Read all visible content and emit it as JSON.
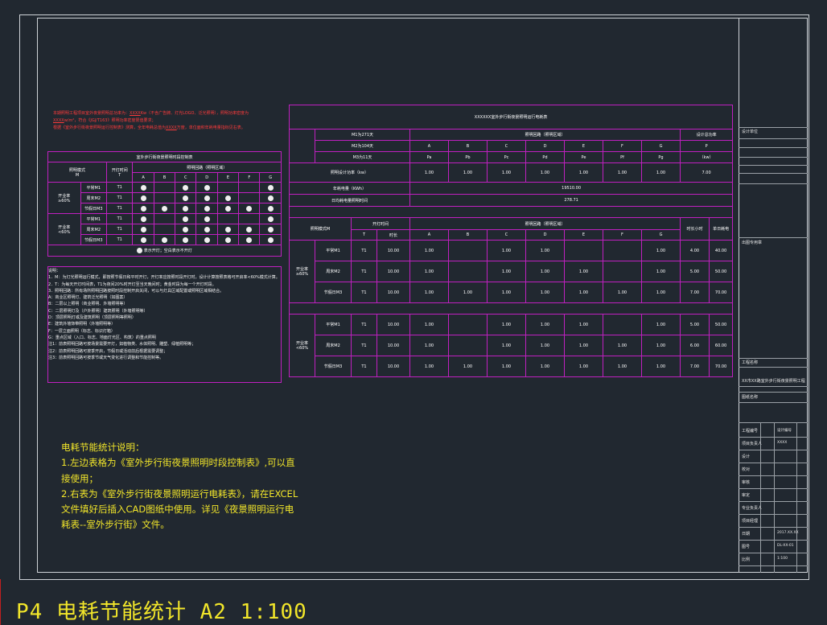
{
  "red_notes": {
    "line1_prefix": "本期照明工程项目室外夜景照明总功率为：",
    "line1_value": "XXXX",
    "line1_suffix": "Kw（不含广告牌、灯光LOGO、泛光照明），照明功率密度为",
    "line2_value": "XXXX",
    "line2_suffix": "w/m²，符合《JGJ/T163》照明功率密度限值要求；",
    "line3_prefix": "根据《室外步行街夜景照明运行控制表》测算，全年电耗总值为",
    "line3_value": "XXXX",
    "line3_suffix": "万度，单位面积年耗电量指标见右表。"
  },
  "left_table": {
    "title": "室外步行街夜景照明时段控制表",
    "col_mode": "照明模式\nM",
    "col_time": "开灯时间\nT",
    "col_range": "照明回路（照明区域）",
    "letters": [
      "A",
      "B",
      "C",
      "D",
      "E",
      "F",
      "G"
    ],
    "groups": [
      {
        "label": "开业率\n≥60%",
        "rows": [
          {
            "mode": "平常M1",
            "t": "T1",
            "dots": [
              1,
              0,
              1,
              1,
              0,
              0,
              1
            ]
          },
          {
            "mode": "周末M2",
            "t": "T1",
            "dots": [
              1,
              0,
              1,
              1,
              1,
              0,
              1
            ]
          },
          {
            "mode": "节假日M3",
            "t": "T1",
            "dots": [
              1,
              1,
              1,
              1,
              1,
              1,
              1
            ]
          }
        ]
      },
      {
        "label": "开业率\n<60%",
        "rows": [
          {
            "mode": "平常M1",
            "t": "T1",
            "dots": [
              1,
              0,
              1,
              1,
              0,
              0,
              1
            ]
          },
          {
            "mode": "周末M2",
            "t": "T1",
            "dots": [
              1,
              0,
              1,
              1,
              1,
              1,
              1
            ]
          },
          {
            "mode": "节假日M3",
            "t": "T1",
            "dots": [
              1,
              1,
              1,
              1,
              1,
              1,
              1
            ]
          }
        ]
      }
    ],
    "legend": "表示开灯；空白表示不开灯"
  },
  "notes": [
    "说明：",
    "1．M：为灯光照明运行模式，即按照节假日和平时开灯，开灯率应按照时段开灯时，设计计算按照表格可开启率<60%模式计算。",
    "2．T：为每天开灯时间表，T1为夜间20%时开灯至当天晚间时；黄金时段为每一个开灯时段。",
    "3．照明回路：所有场所照明回路按照时段控制开启关闭，可以与灯具区域配置或照明区域相结合。",
    "A：商业区照明灯、建筑泛光照明（如图案）",
    "B：二层以上照明（商业照明、外墙照明等）",
    "C：二层照明灯及（户外照明）建筑照明（外墙照明等）",
    "D：顶层照明灯或及建筑照明（顶层照明等照明）",
    "E：建筑外墙饰带照明（外墙照明等）",
    "F：一层立面照明（标志、标识灯箱）",
    "G：重点区域（入口、标志、地面灯光区、构筑）的重点照明",
    "注1：前表照明回路可按场景需要开灯，如植物类、水体照明、雕塑、绿植照明等；",
    "注2：前表照明回路可按季开启，节假日或活动前后根据需要调整；",
    "注3：前表照明回路可按季节或天气变化进行调整和节能控制等。"
  ],
  "right_table": {
    "title": "XXXXXX室外步行街夜景照明运行电耗表",
    "m1": "M1为271天",
    "m2": "M2为104天",
    "m3": "M3为11天",
    "circuit_header": "照明回路（照明区域）",
    "letters": [
      "A",
      "B",
      "C",
      "D",
      "E",
      "F",
      "G"
    ],
    "total_header": "设计总功率",
    "p_labels": [
      "Pa",
      "Pb",
      "Pc",
      "Pd",
      "Pe",
      "Pf",
      "Pg"
    ],
    "p_total_label": "P",
    "p_unit": "（kw）",
    "design_power_label": "照明设计功率（kw）",
    "design_power": [
      "1.00",
      "1.00",
      "1.00",
      "1.00",
      "1.00",
      "1.00",
      "1.00"
    ],
    "design_power_total": "7.00",
    "annual_label": "年耗电量（KWh）",
    "annual_value": "19510.00",
    "daily_label": "日均耗电量照明时间",
    "daily_value": "278.71",
    "mode_header": "照明模式M",
    "time_header": "开灯时间",
    "t_header": "T",
    "hours_header": "时长",
    "hours_col": "时长小时",
    "daily_col": "单日耗电",
    "groups": [
      {
        "label": "开业率\n≥60%",
        "rows": [
          {
            "mode": "平常M1",
            "t": "T1",
            "hrs": "10.00",
            "vals": [
              "1.00",
              "",
              "1.00",
              "1.00",
              "",
              "",
              "1.00"
            ],
            "time": "4.00",
            "energy": "40.00"
          },
          {
            "mode": "周末M2",
            "t": "T1",
            "hrs": "10.00",
            "vals": [
              "1.00",
              "",
              "1.00",
              "1.00",
              "1.00",
              "",
              "1.00"
            ],
            "time": "5.00",
            "energy": "50.00"
          },
          {
            "mode": "节假日M3",
            "t": "T1",
            "hrs": "10.00",
            "vals": [
              "1.00",
              "1.00",
              "1.00",
              "1.00",
              "1.00",
              "1.00",
              "1.00"
            ],
            "time": "7.00",
            "energy": "70.00"
          }
        ]
      },
      {
        "label": "开业率\n<60%",
        "rows": [
          {
            "mode": "平常M1",
            "t": "T1",
            "hrs": "10.00",
            "vals": [
              "1.00",
              "",
              "1.00",
              "1.00",
              "1.00",
              "",
              "1.00"
            ],
            "time": "5.00",
            "energy": "50.00"
          },
          {
            "mode": "周末M2",
            "t": "T1",
            "hrs": "10.00",
            "vals": [
              "1.00",
              "",
              "1.00",
              "1.00",
              "1.00",
              "1.00",
              "1.00"
            ],
            "time": "6.00",
            "energy": "60.00"
          },
          {
            "mode": "节假日M3",
            "t": "T1",
            "hrs": "10.00",
            "vals": [
              "1.00",
              "1.00",
              "1.00",
              "1.00",
              "1.00",
              "1.00",
              "1.00"
            ],
            "time": "7.00",
            "energy": "70.00"
          }
        ]
      }
    ]
  },
  "yellow_notes": {
    "heading": "电耗节能统计说明：",
    "line1": "1.左边表格为《室外步行街夜景照明时段控制表》,可以直接使用；",
    "line2": "2.右表为《室外步行街夜景照明运行电耗表》，请在EXCEL文件填好后插入CAD图纸中使用。详见《夜景照明运行电耗表--室外步行街》文件。"
  },
  "title_block": {
    "company": "设计单位",
    "seal": "出图专用章",
    "project_label": "工程名称",
    "project_name": "XX市XX路室外步行街夜景照明工程",
    "drawing_label": "图纸名称",
    "rows": [
      "工程编号",
      "项目负责人",
      "设计",
      "校对",
      "审核",
      "审定",
      "专业负责人",
      "项目经理",
      "日期",
      "图号",
      "比例"
    ],
    "values": [
      "设计编号",
      "XXXX",
      "",
      "",
      "",
      "",
      "",
      "",
      "2017.XX.XX",
      "DL-XX-01",
      "1:100"
    ]
  },
  "bottom_title": "P4  电耗节能统计  A2  1:100"
}
